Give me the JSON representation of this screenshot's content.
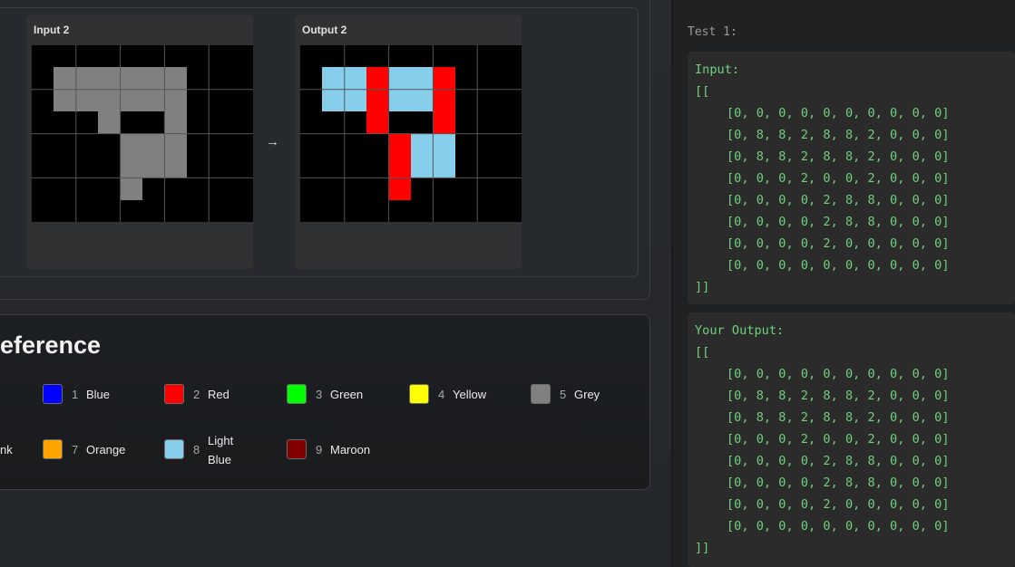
{
  "examples": {
    "input": {
      "title": "Input 2",
      "grid": [
        [
          0,
          0,
          0,
          0,
          0,
          0,
          0,
          0,
          0,
          0
        ],
        [
          0,
          5,
          5,
          5,
          5,
          5,
          5,
          0,
          0,
          0
        ],
        [
          0,
          5,
          5,
          5,
          5,
          5,
          5,
          0,
          0,
          0
        ],
        [
          0,
          0,
          0,
          5,
          0,
          0,
          5,
          0,
          0,
          0
        ],
        [
          0,
          0,
          0,
          0,
          5,
          5,
          5,
          0,
          0,
          0
        ],
        [
          0,
          0,
          0,
          0,
          5,
          5,
          5,
          0,
          0,
          0
        ],
        [
          0,
          0,
          0,
          0,
          5,
          0,
          0,
          0,
          0,
          0
        ],
        [
          0,
          0,
          0,
          0,
          0,
          0,
          0,
          0,
          0,
          0
        ]
      ]
    },
    "arrow": "→",
    "output": {
      "title": "Output 2",
      "grid": [
        [
          0,
          0,
          0,
          0,
          0,
          0,
          0,
          0,
          0,
          0
        ],
        [
          0,
          8,
          8,
          2,
          8,
          8,
          2,
          0,
          0,
          0
        ],
        [
          0,
          8,
          8,
          2,
          8,
          8,
          2,
          0,
          0,
          0
        ],
        [
          0,
          0,
          0,
          2,
          0,
          0,
          2,
          0,
          0,
          0
        ],
        [
          0,
          0,
          0,
          0,
          2,
          8,
          8,
          0,
          0,
          0
        ],
        [
          0,
          0,
          0,
          0,
          2,
          8,
          8,
          0,
          0,
          0
        ],
        [
          0,
          0,
          0,
          0,
          2,
          0,
          0,
          0,
          0,
          0
        ],
        [
          0,
          0,
          0,
          0,
          0,
          0,
          0,
          0,
          0,
          0
        ]
      ]
    }
  },
  "palette": {
    "0": "#000000",
    "1": "#0000ff",
    "2": "#ff0000",
    "3": "#00ff00",
    "4": "#ffff00",
    "5": "#808080",
    "6": "#ff00ff",
    "7": "#ffa500",
    "8": "#87ceeb",
    "9": "#800000"
  },
  "reference": {
    "title": "eference",
    "items": [
      {
        "num": "1",
        "name": "Blue",
        "color": "#0000ff"
      },
      {
        "num": "2",
        "name": "Red",
        "color": "#ff0000"
      },
      {
        "num": "3",
        "name": "Green",
        "color": "#00ff00"
      },
      {
        "num": "4",
        "name": "Yellow",
        "color": "#ffff00"
      },
      {
        "num": "5",
        "name": "Grey",
        "color": "#808080"
      },
      {
        "num": "",
        "name": "nk",
        "color": ""
      },
      {
        "num": "7",
        "name": "Orange",
        "color": "#ffa500"
      },
      {
        "num": "8",
        "name": "Light Blue",
        "color": "#87ceeb"
      },
      {
        "num": "9",
        "name": "Maroon",
        "color": "#800000"
      }
    ]
  },
  "test": {
    "label": "Test 1:",
    "input": {
      "header": "Input:",
      "open": "[[",
      "rows": [
        "[0, 0, 0, 0, 0, 0, 0, 0, 0, 0]",
        "[0, 8, 8, 2, 8, 8, 2, 0, 0, 0]",
        "[0, 8, 8, 2, 8, 8, 2, 0, 0, 0]",
        "[0, 0, 0, 2, 0, 0, 2, 0, 0, 0]",
        "[0, 0, 0, 0, 2, 8, 8, 0, 0, 0]",
        "[0, 0, 0, 0, 2, 8, 8, 0, 0, 0]",
        "[0, 0, 0, 0, 2, 0, 0, 0, 0, 0]",
        "[0, 0, 0, 0, 0, 0, 0, 0, 0, 0]"
      ],
      "close": "]]"
    },
    "output": {
      "header": "Your Output:",
      "open": "[[",
      "rows": [
        "[0, 0, 0, 0, 0, 0, 0, 0, 0, 0]",
        "[0, 8, 8, 2, 8, 8, 2, 0, 0, 0]",
        "[0, 8, 8, 2, 8, 8, 2, 0, 0, 0]",
        "[0, 0, 0, 2, 0, 0, 2, 0, 0, 0]",
        "[0, 0, 0, 0, 2, 8, 8, 0, 0, 0]",
        "[0, 0, 0, 0, 2, 8, 8, 0, 0, 0]",
        "[0, 0, 0, 0, 2, 0, 0, 0, 0, 0]",
        "[0, 0, 0, 0, 0, 0, 0, 0, 0, 0]"
      ],
      "close": "]]"
    }
  }
}
